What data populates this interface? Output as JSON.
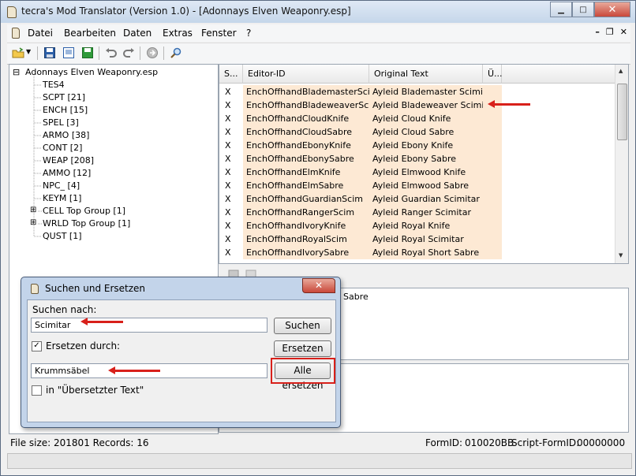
{
  "window": {
    "title": "tecra's Mod Translator (Version 1.0) - [Adonnays Elven Weaponry.esp]"
  },
  "menu": {
    "items": [
      "Datei",
      "Bearbeiten",
      "Daten",
      "Extras",
      "Fenster",
      "?"
    ]
  },
  "tree": {
    "root": "Adonnays Elven Weaponry.esp",
    "items": [
      {
        "label": "TES4",
        "expandable": false
      },
      {
        "label": "SCPT [21]",
        "expandable": false
      },
      {
        "label": "ENCH [15]",
        "expandable": false
      },
      {
        "label": "SPEL [3]",
        "expandable": false
      },
      {
        "label": "ARMO [38]",
        "expandable": false
      },
      {
        "label": "CONT [2]",
        "expandable": false
      },
      {
        "label": "WEAP [208]",
        "expandable": false
      },
      {
        "label": "AMMO [12]",
        "expandable": false
      },
      {
        "label": "NPC_ [4]",
        "expandable": false
      },
      {
        "label": "KEYM [1]",
        "expandable": false
      },
      {
        "label": "CELL Top Group [1]",
        "expandable": true
      },
      {
        "label": "WRLD Top Group [1]",
        "expandable": true
      },
      {
        "label": "QUST [1]",
        "expandable": false
      }
    ]
  },
  "grid": {
    "headers": [
      "S...",
      "Editor-ID",
      "Original Text",
      "Ü..."
    ],
    "rows": [
      [
        "X",
        "EnchOffhandBlademasterScim",
        "Ayleid Blademaster Scimitar"
      ],
      [
        "X",
        "EnchOffhandBladeweaverScim",
        "Ayleid Bladeweaver Scimitar"
      ],
      [
        "X",
        "EnchOffhandCloudKnife",
        "Ayleid Cloud Knife"
      ],
      [
        "X",
        "EnchOffhandCloudSabre",
        "Ayleid Cloud Sabre"
      ],
      [
        "X",
        "EnchOffhandEbonyKnife",
        "Ayleid Ebony Knife"
      ],
      [
        "X",
        "EnchOffhandEbonySabre",
        "Ayleid Ebony Sabre"
      ],
      [
        "X",
        "EnchOffhandElmKnife",
        "Ayleid Elmwood Knife"
      ],
      [
        "X",
        "EnchOffhandElmSabre",
        "Ayleid Elmwood Sabre"
      ],
      [
        "X",
        "EnchOffhandGuardianScim",
        "Ayleid Guardian Scimitar"
      ],
      [
        "X",
        "EnchOffhandRangerScim",
        "Ayleid Ranger Scimitar"
      ],
      [
        "X",
        "EnchOffhandIvoryKnife",
        "Ayleid Royal Knife"
      ],
      [
        "X",
        "EnchOffhandRoyalScim",
        "Ayleid Royal Scimitar"
      ],
      [
        "X",
        "EnchOffhandIvorySabre",
        "Ayleid Royal Short Sabre"
      ]
    ]
  },
  "editor": {
    "visible_text": "Sabre"
  },
  "status": {
    "file_info": "File size: 201801 Records: 16",
    "formid_label": "FormID:",
    "formid_value": "010020BB",
    "script_label": "Script-FormID:",
    "script_value": "00000000"
  },
  "dialog": {
    "title": "Suchen und Ersetzen",
    "search_label": "Suchen nach:",
    "search_value": "Scimitar",
    "search_button": "Suchen",
    "replace_checkbox_label": "Ersetzen durch:",
    "replace_checked": true,
    "replace_button": "Ersetzen",
    "replace_value": "Krummsäbel",
    "replace_all_button": "Alle ersetzen",
    "in_translated_label": "in \"Übersetzter Text\"",
    "in_translated_checked": false
  },
  "colors": {
    "highlight": "#d8201a",
    "row_tint": "#fde9d4"
  }
}
